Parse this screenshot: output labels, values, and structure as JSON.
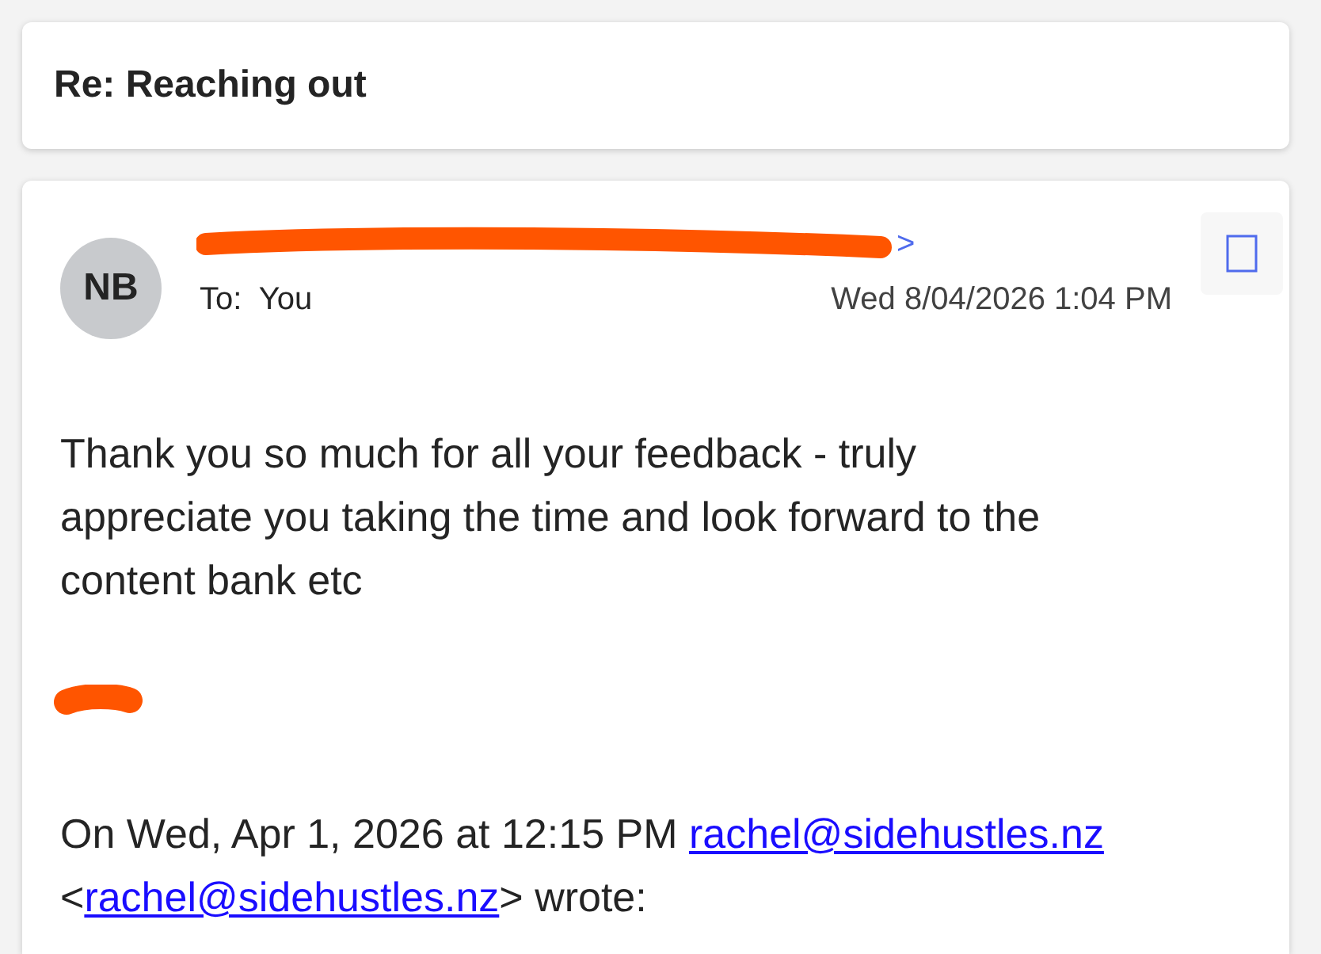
{
  "subject": "Re: Reaching out",
  "message": {
    "avatar_initials": "NB",
    "sender": {
      "redacted": true,
      "visible_text": ">"
    },
    "to_label": "To:",
    "to_value": "You",
    "date": "Wed 8/04/2026 1:04 PM",
    "body": "Thank you so much for all your feedback - truly appreciate you taking the time and look forward to the content bank etc",
    "signature": {
      "redacted": true
    },
    "quote": [
      {
        "kind": "text",
        "text": "On Wed, Apr 1, 2026 at 12:15 PM "
      },
      {
        "kind": "link",
        "text": "rachel@sidehustles.nz"
      },
      {
        "kind": "text",
        "text": " <"
      },
      {
        "kind": "link",
        "text": "rachel@sidehustles.nz"
      },
      {
        "kind": "text",
        "text": "> wrote:"
      }
    ]
  }
}
